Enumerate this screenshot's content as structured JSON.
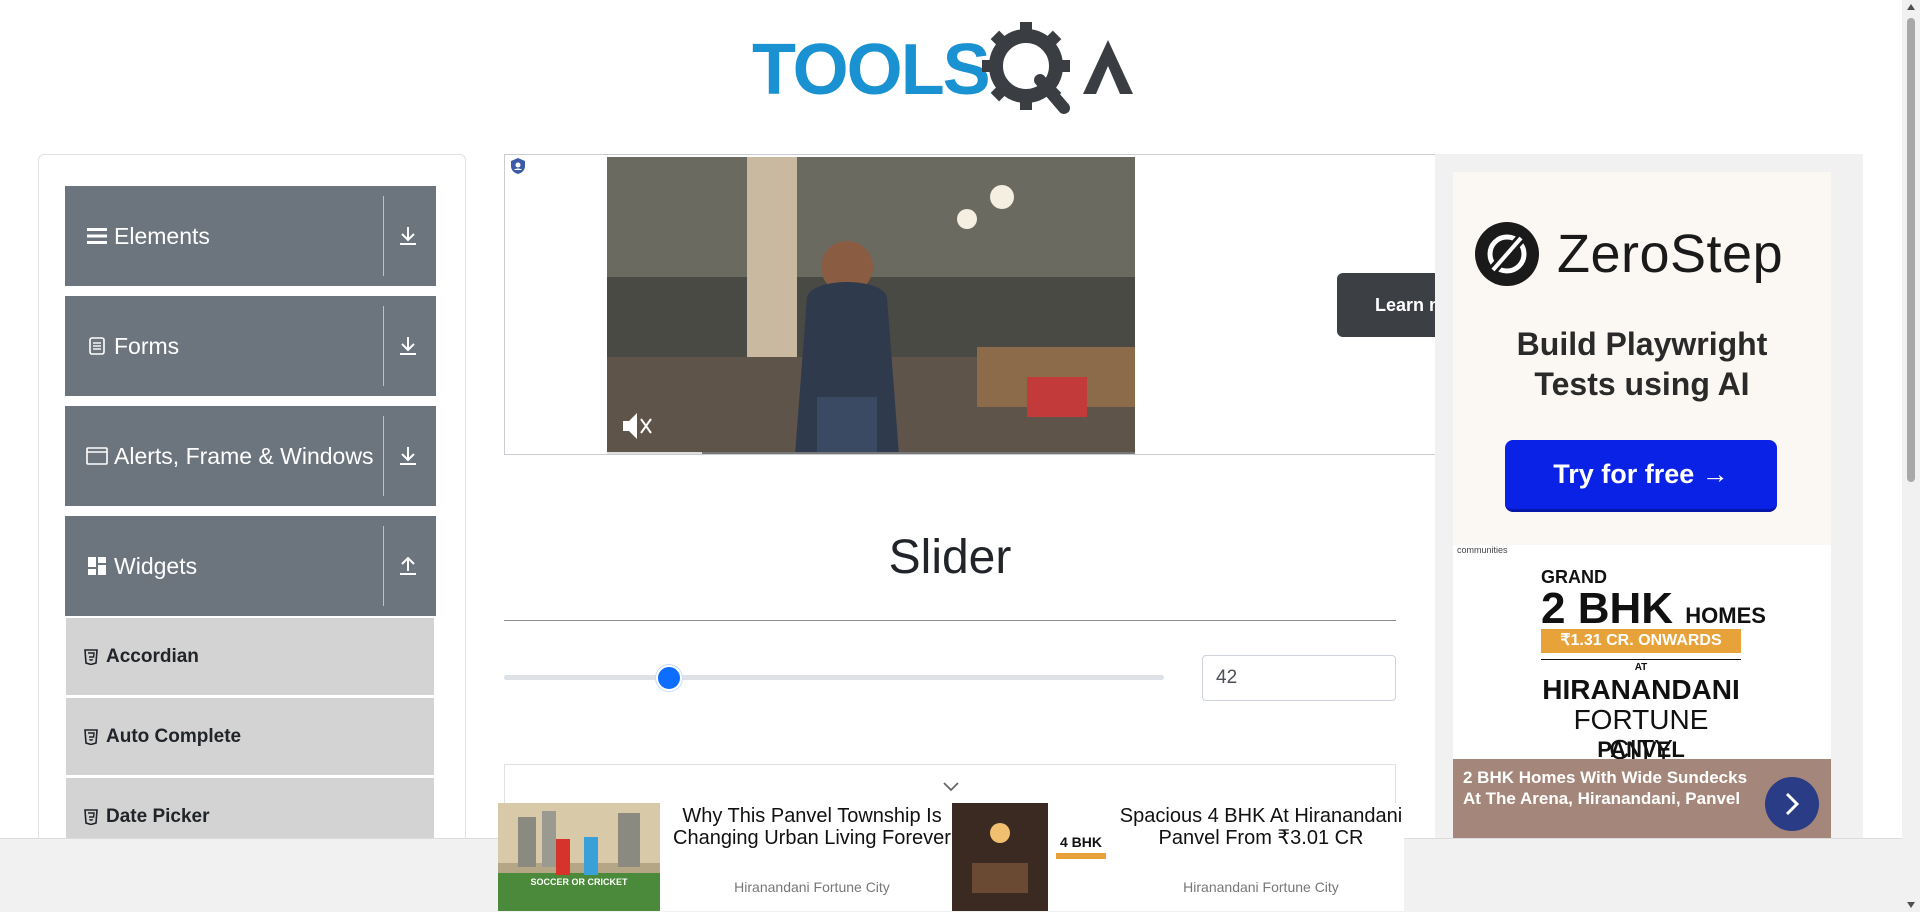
{
  "header": {
    "logo_text_tools": "TOOLS",
    "logo_text_qa": "QA"
  },
  "sidebar": {
    "groups": [
      {
        "label": "Elements",
        "icon": "hamburger-icon",
        "state": "collapsed"
      },
      {
        "label": "Forms",
        "icon": "document-icon",
        "state": "collapsed"
      },
      {
        "label": "Alerts, Frame & Windows",
        "icon": "window-icon",
        "state": "collapsed"
      },
      {
        "label": "Widgets",
        "icon": "grid-icon",
        "state": "expanded"
      }
    ],
    "widget_items": [
      {
        "label": "Accordian",
        "icon": "html5-icon"
      },
      {
        "label": "Auto Complete",
        "icon": "html5-icon"
      },
      {
        "label": "Date Picker",
        "icon": "html5-icon"
      }
    ]
  },
  "video_ad": {
    "button_label": "Learn m"
  },
  "right_ad": {
    "brand": "ZeroStep",
    "tagline_line1": "Build Playwright",
    "tagline_line2": "Tests using AI",
    "cta": "Try for free →",
    "hir_top": "communities",
    "hir_grand": "GRAND",
    "hir_2bhk": "2 BHK",
    "hir_homes": "HOMES",
    "hir_price": "₹1.31 CR. ONWARDS",
    "hir_at": "AT",
    "hir_name": "HIRANANDANI",
    "hir_city": "FORTUNE CITY",
    "hir_panvel": "PANVEL",
    "hir_caption": "2 BHK Homes With Wide Sundecks At The Arena, Hiranandani, Panvel"
  },
  "main": {
    "title": "Slider",
    "slider_value": "42",
    "slider_percent": 0.25
  },
  "bottom_ads": [
    {
      "headline": "Why This Panvel Township Is Changing Urban Living Forever",
      "source": "Hiranandani Fortune City",
      "img_caption": "SOCCER OR CRICKET"
    },
    {
      "headline": "Spacious 4 BHK At Hiranandani Panvel From ₹3.01 CR",
      "source": "Hiranandani Fortune City",
      "img_caption": "4 BHK"
    }
  ],
  "colors": {
    "sidebar_group": "#6c757d",
    "sidebar_item": "#d3d3d3",
    "slider_thumb": "#0d6efd",
    "zerostep_button": "#0a22e6",
    "logo_blue": "#1a91d0"
  }
}
